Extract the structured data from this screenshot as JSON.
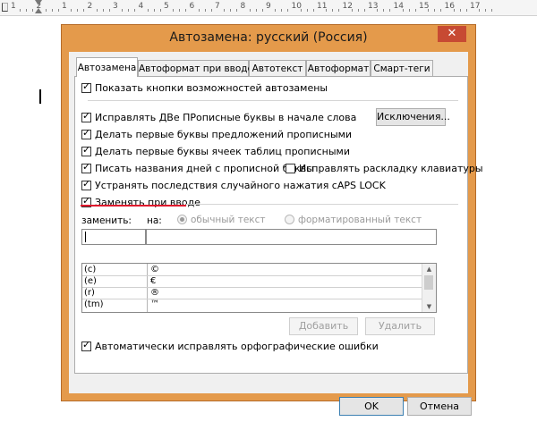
{
  "ruler": {
    "numbers": [
      "1",
      "2",
      "1",
      "2",
      "3",
      "4",
      "5",
      "6",
      "7",
      "8",
      "9",
      "10",
      "11",
      "12",
      "13",
      "14",
      "15",
      "16",
      "17"
    ]
  },
  "dialog": {
    "title": "Автозамена: русский (Россия)",
    "close_glyph": "✕",
    "tabs": [
      {
        "label": "Автозамена",
        "active": true
      },
      {
        "label": "Автоформат при вводе",
        "active": false
      },
      {
        "label": "Автотекст",
        "active": false
      },
      {
        "label": "Автоформат",
        "active": false
      },
      {
        "label": "Смарт-теги",
        "active": false
      }
    ],
    "show_buttons": {
      "label": "Показать кнопки возможностей автозамены",
      "checked": true
    },
    "options": [
      {
        "label": "Исправлять ДВе ПРописные буквы в начале слова",
        "checked": true
      },
      {
        "label": "Делать первые буквы предложений прописными",
        "checked": true
      },
      {
        "label": "Делать первые буквы ячеек таблиц прописными",
        "checked": true
      },
      {
        "label": "Писать названия дней с прописной буквы",
        "checked": true
      },
      {
        "label": "Устранять последствия случайного нажатия cAPS LOCK",
        "checked": true
      }
    ],
    "fix_layout": {
      "label": "Исправлять раскладку клавиатуры",
      "checked": false
    },
    "exceptions_button": "Исключения...",
    "replace_as_you_type": {
      "label": "Заменять при вводе",
      "checked": true
    },
    "replace_label": "заменить:",
    "with_label": "на:",
    "plain_text": {
      "label": "обычный текст",
      "selected": true
    },
    "formatted_text": {
      "label": "форматированный текст",
      "selected": false
    },
    "replace_value": "",
    "with_value": "",
    "entries": [
      {
        "from": "(c)",
        "to": "©"
      },
      {
        "from": "(e)",
        "to": "€"
      },
      {
        "from": "(r)",
        "to": "®"
      },
      {
        "from": "(tm)",
        "to": "™"
      }
    ],
    "add_button": "Добавить",
    "delete_button": "Удалить",
    "spellcheck": {
      "label": "Автоматически исправлять орфографические ошибки",
      "checked": true
    },
    "ok_button": "OK",
    "cancel_button": "Отмена"
  },
  "colors": {
    "frame": "#e49a4b",
    "close": "#c74a33",
    "highlight": "#e0182d"
  }
}
